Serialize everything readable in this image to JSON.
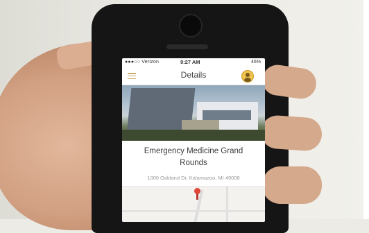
{
  "status_bar": {
    "carrier": "●●●○○ Verizon",
    "time": "9:27 AM",
    "battery": "46%"
  },
  "nav": {
    "title": "Details"
  },
  "event": {
    "title_line1": "Emergency Medicine Grand",
    "title_line2": "Rounds",
    "address": "1000 Oakland Dr, Kalamazoo, MI 49008"
  },
  "icons": {
    "menu": "menu-icon",
    "profile": "profile-icon",
    "map_pin": "map-pin-icon"
  },
  "colors": {
    "accent": "#c9a96a",
    "profile": "#f0c34c",
    "pin": "#e2463a"
  }
}
